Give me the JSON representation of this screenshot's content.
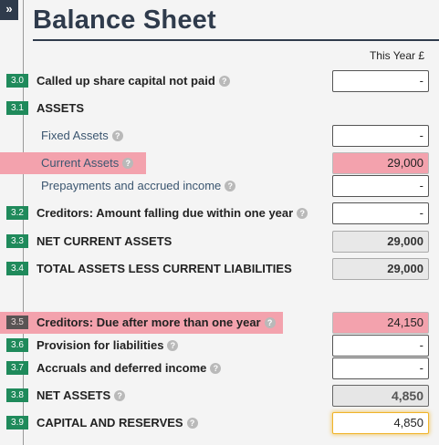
{
  "toggle_glyph": "»",
  "title": "Balance Sheet",
  "column_header": "This Year £",
  "help_glyph": "?",
  "rows": [
    {
      "code": "3.0",
      "label": "Called up share capital not paid",
      "value": "-"
    },
    {
      "code": "3.1",
      "label": "ASSETS"
    },
    {
      "label": "Fixed Assets",
      "value": "-"
    },
    {
      "label": "Current Assets",
      "value": "29,000"
    },
    {
      "label": "Prepayments and accrued income",
      "value": "-"
    },
    {
      "code": "3.2",
      "label": "Creditors: Amount falling due within one year",
      "value": "-"
    },
    {
      "code": "3.3",
      "label": "NET CURRENT ASSETS",
      "value": "29,000"
    },
    {
      "code": "3.4",
      "label": "TOTAL ASSETS LESS CURRENT LIABILITIES",
      "value": "29,000"
    },
    {
      "code": "3.5",
      "label": "Creditors: Due after more than one year",
      "value": "24,150"
    },
    {
      "code": "3.6",
      "label": "Provision for liabilities",
      "value": "-"
    },
    {
      "code": "3.7",
      "label": "Accruals and deferred income",
      "value": "-"
    },
    {
      "code": "3.8",
      "label": "NET ASSETS",
      "value": "4,850"
    },
    {
      "code": "3.9",
      "label": "CAPITAL AND RESERVES",
      "value": "4,850"
    }
  ],
  "colors": {
    "accent_green": "#1f8a5b",
    "highlight_pink": "#f3a2ad",
    "title_navy": "#2f3b4c",
    "focus_orange": "#f0b429"
  }
}
